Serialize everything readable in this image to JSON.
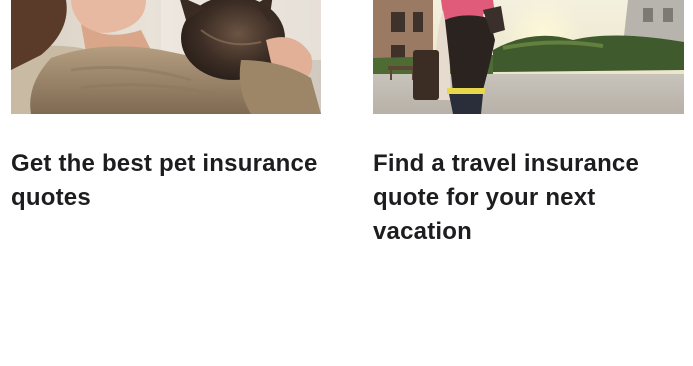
{
  "cards": [
    {
      "image_alt": "",
      "headline": "Get the best pet insurance quotes"
    },
    {
      "image_alt": "",
      "headline": "Find a travel insurance quote for your next vacation"
    }
  ]
}
